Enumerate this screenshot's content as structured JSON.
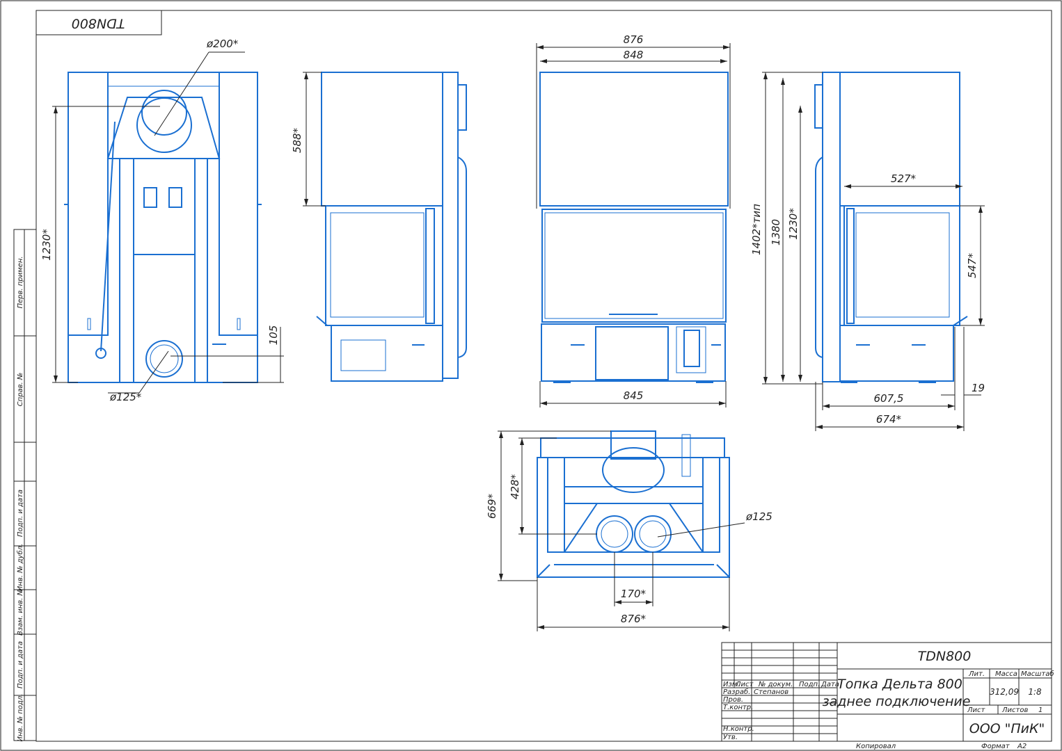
{
  "stamp_code": "TDN800",
  "side_labels": [
    "Перв. примен.",
    "Справ. №",
    "Подп. и дата",
    "Инв. № дубл.",
    "Взам. инв. №",
    "Подп. и дата",
    "Инв. № подл."
  ],
  "dimensions": {
    "front": {
      "flue_diameter": "ø200*",
      "height": "1230*",
      "inlet_height": "105",
      "inlet_diameter": "ø125*"
    },
    "side_left": {
      "top_height": "588*"
    },
    "front_glass": {
      "overall_width": "876",
      "inner_width": "848",
      "base_width": "845"
    },
    "side_right": {
      "total_height": "1402*тип",
      "height_1380": "1380",
      "height_1230": "1230*",
      "top_depth": "527*",
      "glass_height": "547*",
      "depth_607": "607,5",
      "offset_19": "19",
      "depth_674": "674*"
    },
    "top_view": {
      "depth": "669*",
      "depth_inner": "428*",
      "pipe_diameter": "ø125",
      "pipe_spacing": "170*",
      "width": "876*"
    }
  },
  "title_block": {
    "code": "TDN800",
    "name_line1": "Топка Дельта 800",
    "name_line2": "заднее подключение",
    "col_headers": [
      "Изм.",
      "Лист",
      "№ докум.",
      "Подп.",
      "Дата"
    ],
    "rows": [
      {
        "role": "Разраб.",
        "name": "Степанов"
      },
      {
        "role": "Пров.",
        "name": ""
      },
      {
        "role": "Т.контр.",
        "name": ""
      },
      {
        "role": "",
        "name": ""
      },
      {
        "role": "Н.контр.",
        "name": ""
      },
      {
        "role": "Утв.",
        "name": ""
      }
    ],
    "lit_label": "Лит.",
    "mass_label": "Масса",
    "scale_label": "Масштаб",
    "mass": "312,09",
    "scale": "1:8",
    "sheet_label": "Лист",
    "sheets_label": "Листов",
    "sheets_count": "1",
    "company": "ООО \"ПиК\"",
    "copied_label": "Копировал",
    "format_label": "Формат",
    "format_value": "A2"
  }
}
